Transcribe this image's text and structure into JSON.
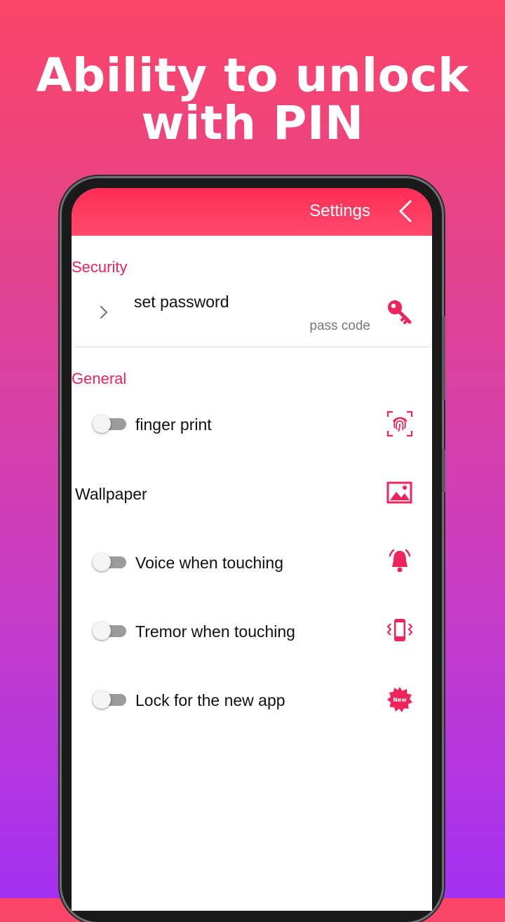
{
  "headline": {
    "line1": "Ability to unlock",
    "line2": "with PIN"
  },
  "appbar": {
    "title": "Settings",
    "back_icon": "chevron-left-icon"
  },
  "sections": {
    "security": {
      "label": "Security",
      "set_password": {
        "title": "set password",
        "subtitle": "pass code",
        "icon": "key-icon"
      }
    },
    "general": {
      "label": "General",
      "fingerprint": {
        "label": "finger print",
        "enabled": false,
        "icon": "fingerprint-icon"
      },
      "wallpaper": {
        "label": "Wallpaper",
        "icon": "image-icon"
      },
      "voice": {
        "label": "Voice when touching",
        "enabled": false,
        "icon": "bell-ringing-icon"
      },
      "tremor": {
        "label": "Tremor when touching",
        "enabled": false,
        "icon": "phone-vibrate-icon"
      },
      "lock_new_app": {
        "label": "Lock for the new app",
        "enabled": false,
        "icon": "new-badge-icon",
        "badge_text": "New"
      }
    }
  },
  "colors": {
    "accent": "#f0245c",
    "appbar": "#ff2d55",
    "toggle_off": "#9b9b9b"
  }
}
